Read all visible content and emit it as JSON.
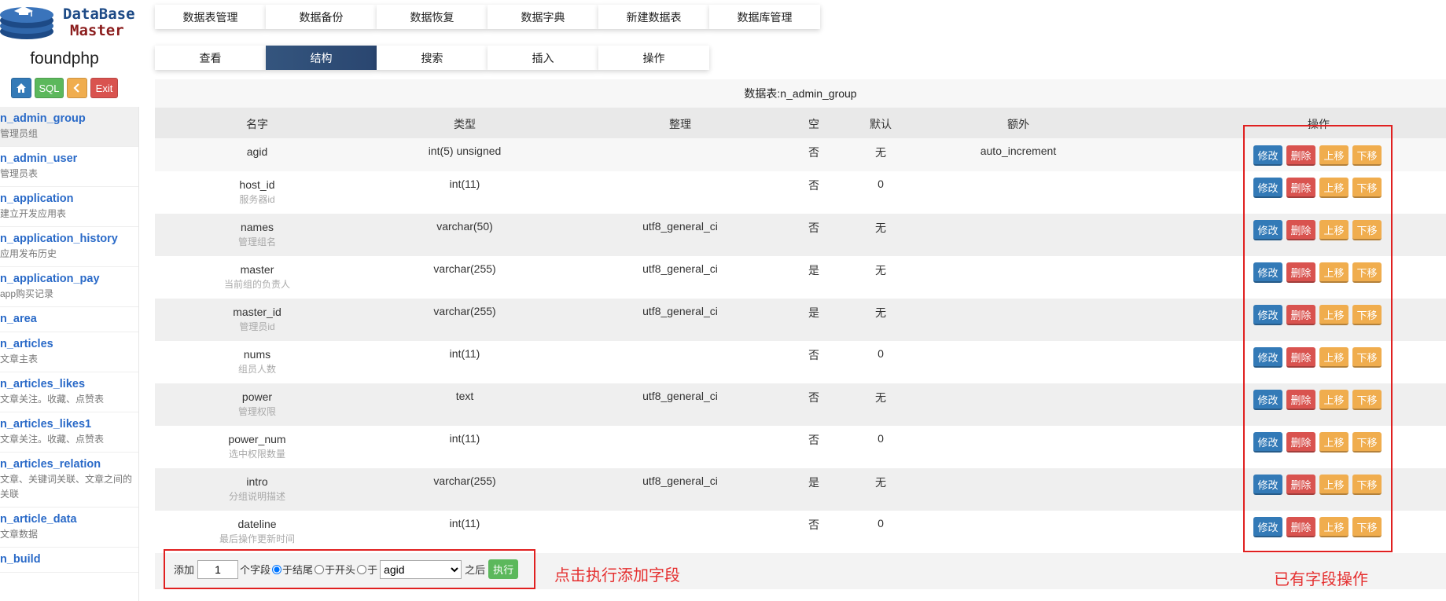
{
  "sidebar": {
    "logo": {
      "line1": "DataBase",
      "line2": "Master"
    },
    "site_name": "foundphp",
    "quick_buttons": {
      "home": "⌂",
      "sql": "SQL",
      "back": "‹",
      "exit": "Exit"
    },
    "tables": [
      {
        "name": "n_admin_group",
        "desc": "管理员组"
      },
      {
        "name": "n_admin_user",
        "desc": "管理员表"
      },
      {
        "name": "n_application",
        "desc": "建立开发应用表"
      },
      {
        "name": "n_application_history",
        "desc": "应用发布历史"
      },
      {
        "name": "n_application_pay",
        "desc": "app购买记录"
      },
      {
        "name": "n_area",
        "desc": ""
      },
      {
        "name": "n_articles",
        "desc": "文章主表"
      },
      {
        "name": "n_articles_likes",
        "desc": "文章关注。收藏、点赞表"
      },
      {
        "name": "n_articles_likes1",
        "desc": "文章关注。收藏、点赞表"
      },
      {
        "name": "n_articles_relation",
        "desc": "文章、关键词关联、文章之间的关联"
      },
      {
        "name": "n_article_data",
        "desc": "文章数据"
      },
      {
        "name": "n_build",
        "desc": ""
      }
    ]
  },
  "nav_main": [
    "数据表管理",
    "数据备份",
    "数据恢复",
    "数据字典",
    "新建数据表",
    "数据库管理"
  ],
  "nav_sub": [
    "查看",
    "结构",
    "搜索",
    "插入",
    "操作"
  ],
  "nav_sub_active": "结构",
  "table": {
    "caption": "数据表:n_admin_group",
    "headers": {
      "name": "名字",
      "type": "类型",
      "collation": "整理",
      "null": "空",
      "default": "默认",
      "extra": "额外",
      "action": "操作"
    },
    "rows": [
      {
        "name": "agid",
        "desc": "",
        "type": "int(5) unsigned",
        "collation": "",
        "null": "否",
        "default": "无",
        "extra": "auto_increment"
      },
      {
        "name": "host_id",
        "desc": "服务器id",
        "type": "int(11)",
        "collation": "",
        "null": "否",
        "default": "0",
        "extra": ""
      },
      {
        "name": "names",
        "desc": "管理组名",
        "type": "varchar(50)",
        "collation": "utf8_general_ci",
        "null": "否",
        "default": "无",
        "extra": ""
      },
      {
        "name": "master",
        "desc": "当前组的负责人",
        "type": "varchar(255)",
        "collation": "utf8_general_ci",
        "null": "是",
        "default": "无",
        "extra": ""
      },
      {
        "name": "master_id",
        "desc": "管理员id",
        "type": "varchar(255)",
        "collation": "utf8_general_ci",
        "null": "是",
        "default": "无",
        "extra": ""
      },
      {
        "name": "nums",
        "desc": "组员人数",
        "type": "int(11)",
        "collation": "",
        "null": "否",
        "default": "0",
        "extra": ""
      },
      {
        "name": "power",
        "desc": "管理权限",
        "type": "text",
        "collation": "utf8_general_ci",
        "null": "否",
        "default": "无",
        "extra": ""
      },
      {
        "name": "power_num",
        "desc": "选中权限数量",
        "type": "int(11)",
        "collation": "",
        "null": "否",
        "default": "0",
        "extra": ""
      },
      {
        "name": "intro",
        "desc": "分组说明描述",
        "type": "varchar(255)",
        "collation": "utf8_general_ci",
        "null": "是",
        "default": "无",
        "extra": ""
      },
      {
        "name": "dateline",
        "desc": "最后操作更新时间",
        "type": "int(11)",
        "collation": "",
        "null": "否",
        "default": "0",
        "extra": ""
      }
    ],
    "row_actions": {
      "edit": "修改",
      "delete": "删除",
      "up": "上移",
      "down": "下移"
    }
  },
  "add_field": {
    "label_add": "添加",
    "count_value": "1",
    "label_fields": "个字段",
    "opt_end": "于结尾",
    "opt_start": "于开头",
    "opt_after": "于",
    "after_select": "agid",
    "label_after": "之后",
    "run": "执行"
  },
  "annotations": {
    "add_hint": "点击执行添加字段",
    "ops_hint": "已有字段操作"
  }
}
